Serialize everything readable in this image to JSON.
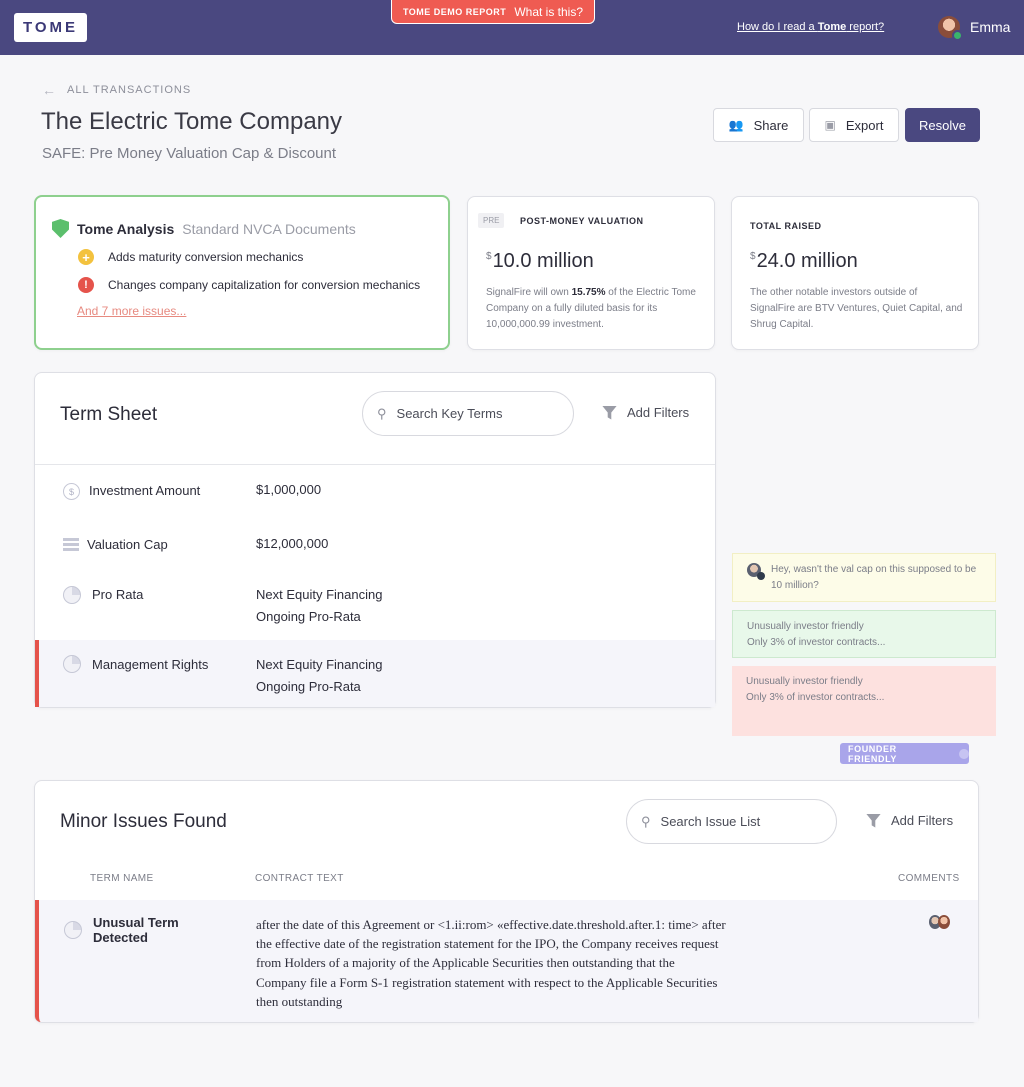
{
  "header": {
    "logo": "TOME",
    "demo_label": "TOME DEMO REPORT",
    "demo_link": "What is this?",
    "help_prefix": "How do I read a ",
    "help_brand": "Tome",
    "help_suffix": " report?",
    "user_name": "Emma"
  },
  "page": {
    "back_label": "ALL TRANSACTIONS",
    "title": "The Electric Tome Company",
    "subtitle": "SAFE: Pre Money Valuation Cap & Discount"
  },
  "actions": {
    "share": "Share",
    "export": "Export",
    "resolve": "Resolve"
  },
  "analysis": {
    "title": "Tome Analysis",
    "subtitle": "Standard NVCA Documents",
    "issues": [
      "Adds maturity conversion mechanics",
      "Changes company capitalization for conversion mechanics"
    ],
    "more_link": "And 7 more issues..."
  },
  "metrics": [
    {
      "tag": "PRE",
      "label": "POST-MONEY VALUATION",
      "currency": "$",
      "value": "10.0 million",
      "desc_before": "SignalFire will own ",
      "desc_bold": "15.75%",
      "desc_after": " of the Electric Tome Company on a fully diluted basis for its 10,000,000.99 investment."
    },
    {
      "label": "TOTAL RAISED",
      "currency": "$",
      "value": "24.0 million",
      "desc": "The other notable investors outside of SignalFire are BTV Ventures, Quiet Capital, and Shrug Capital."
    }
  ],
  "term_sheet": {
    "title": "Term Sheet",
    "search_placeholder": "Search Key Terms",
    "filters_label": "Add Filters",
    "rows": [
      {
        "name": "Investment Amount",
        "values": [
          "$1,000,000"
        ],
        "icon": "dollar-coin-icon"
      },
      {
        "name": "Valuation Cap",
        "values": [
          "$12,000,000"
        ],
        "icon": "bars-icon"
      },
      {
        "name": "Pro Rata",
        "values": [
          "Next Equity Financing",
          "Ongoing Pro-Rata"
        ],
        "icon": "pie-chart-icon"
      },
      {
        "name": "Management Rights",
        "values": [
          "Next Equity Financing",
          "Ongoing Pro-Rata"
        ],
        "icon": "pie-chart-icon",
        "highlight": true
      }
    ]
  },
  "comments": [
    {
      "text": "Hey, wasn't the val cap on this supposed to be 10 million?",
      "color": "#fdfce8"
    },
    {
      "text": "Unusually investor friendly\nOnly 3% of investor contracts...",
      "color": "#e8f8ea"
    },
    {
      "text": "Unusually investor friendly\nOnly 3% of investor contracts...",
      "color": "#fde1df"
    }
  ],
  "founder_badge": "FOUNDER FRIENDLY",
  "minor_issues": {
    "title": "Minor Issues Found",
    "search_placeholder": "Search Issue List",
    "filters_label": "Add Filters",
    "columns": [
      "TERM NAME",
      "CONTRACT TEXT",
      "COMMENTS"
    ],
    "rows": [
      {
        "term_name": "Unusual Term Detected",
        "contract_text": "after the date of this Agreement or <1.ii:rom> «effective.date.threshold.after.1: time> after the effective date of the registration statement for the IPO, the Company receives request from Holders of a majority of the Applicable Securities then outstanding that the Company file a Form S-1 registration statement with respect to the Applicable Securities then outstanding"
      }
    ]
  },
  "colors": {
    "brand": "#4a4880",
    "accent_red": "#e5534b",
    "accent_green": "#5bbf6c",
    "badge_purple": "#a9a5ea"
  }
}
